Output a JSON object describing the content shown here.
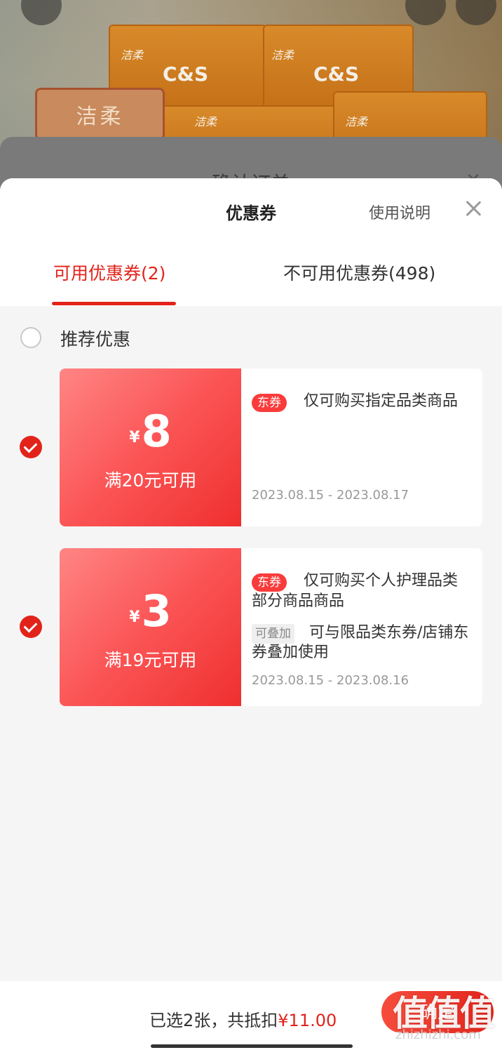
{
  "background": {
    "brand_logo": "C&S",
    "brand_cn": "洁柔",
    "sheet_title": "确认订单"
  },
  "sheet": {
    "title": "优惠券",
    "usage_link": "使用说明"
  },
  "tabs": [
    {
      "label": "可用优惠券(2)",
      "active": true
    },
    {
      "label": "不可用优惠券(498)",
      "active": false
    }
  ],
  "recommend": {
    "label": "推荐优惠",
    "checked": false
  },
  "coupons": [
    {
      "currency": "¥",
      "amount": "8",
      "threshold": "满20元可用",
      "tag": "东券",
      "description": "仅可购买指定品类商品",
      "date_range": "2023.08.15 - 2023.08.17",
      "checked": true
    },
    {
      "currency": "¥",
      "amount": "3",
      "threshold": "满19元可用",
      "tag": "东券",
      "description": "仅可购买个人护理品类部分商品商品",
      "stack_tag": "可叠加",
      "stack_description": "可与限品类东券/店铺东券叠加使用",
      "date_range": "2023.08.15 - 2023.08.16",
      "checked": true
    }
  ],
  "footer": {
    "summary_prefix": "已选2张，共抵扣",
    "summary_amount": "¥11.00",
    "confirm_label": "确定"
  },
  "watermark": {
    "big": "值值值",
    "small": "zhizhizhi.com"
  },
  "colors": {
    "accent": "#e2231a",
    "coupon_gradient_start": "#ff8585",
    "coupon_gradient_end": "#ef2f2f"
  }
}
